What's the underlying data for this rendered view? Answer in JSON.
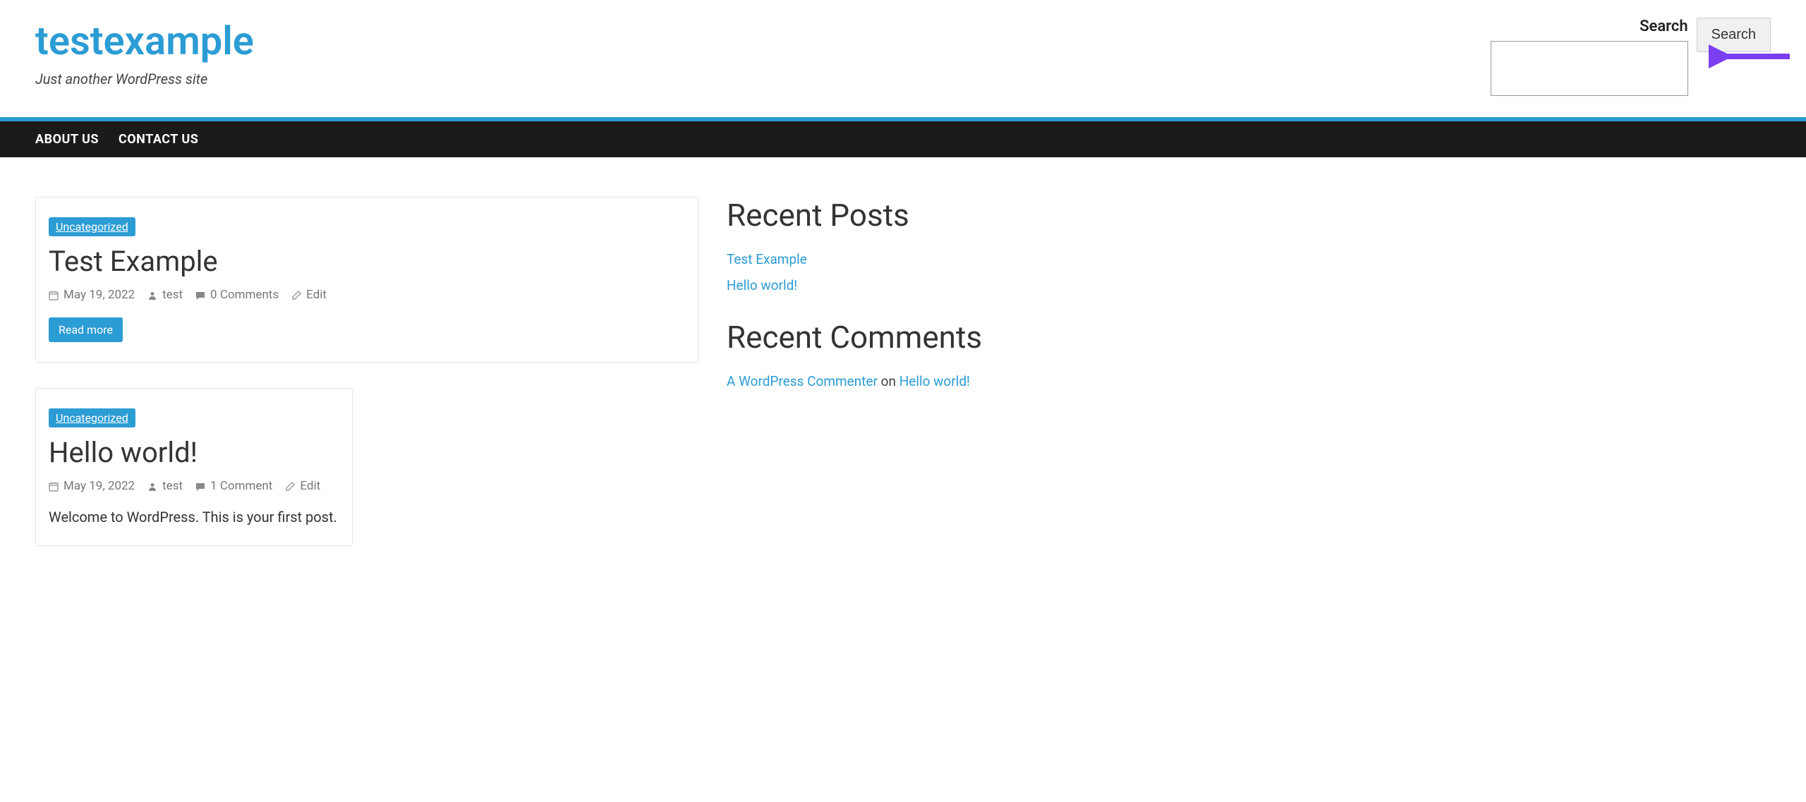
{
  "site": {
    "title": "testexample",
    "tagline": "Just another WordPress site"
  },
  "search": {
    "label": "Search",
    "button": "Search"
  },
  "nav": {
    "items": [
      {
        "label": "ABOUT US"
      },
      {
        "label": "CONTACT US"
      }
    ]
  },
  "posts": [
    {
      "category": "Uncategorized",
      "title": "Test Example",
      "date": "May 19, 2022",
      "author": "test",
      "comments": "0 Comments",
      "edit": "Edit",
      "read_more": "Read more"
    },
    {
      "category": "Uncategorized",
      "title": "Hello world!",
      "date": "May 19, 2022",
      "author": "test",
      "comments": "1 Comment",
      "edit": "Edit",
      "excerpt": "Welcome to WordPress. This is your first post."
    }
  ],
  "sidebar": {
    "recent_posts": {
      "title": "Recent Posts",
      "items": [
        {
          "label": "Test Example"
        },
        {
          "label": "Hello world!"
        }
      ]
    },
    "recent_comments": {
      "title": "Recent Comments",
      "items": [
        {
          "author": "A WordPress Commenter",
          "on": " on ",
          "post": "Hello world!"
        }
      ]
    }
  }
}
